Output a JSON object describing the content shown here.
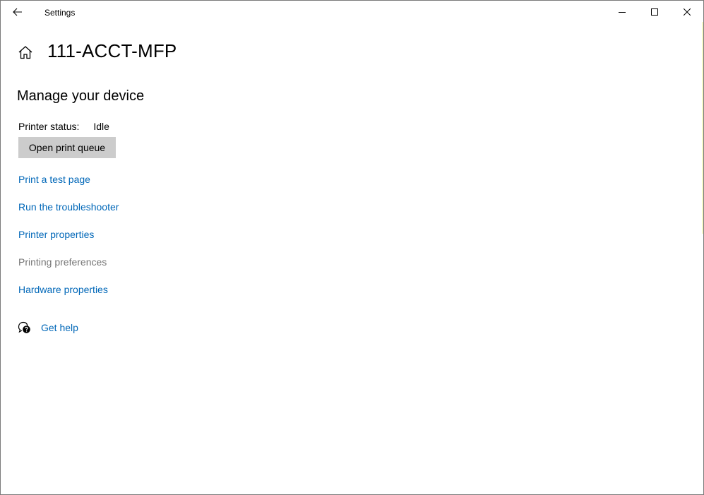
{
  "window": {
    "title": "Settings"
  },
  "icons": {
    "back": "back-arrow-icon",
    "home": "home-icon",
    "help": "help-chat-icon",
    "minimize": "minimize-icon",
    "maximize": "maximize-icon",
    "close": "close-icon"
  },
  "page": {
    "title": "111-ACCT-MFP",
    "section_heading": "Manage your device"
  },
  "status": {
    "label": "Printer status:",
    "value": "Idle"
  },
  "actions": {
    "open_queue_label": "Open print queue"
  },
  "links": [
    {
      "label": "Print a test page",
      "enabled": true
    },
    {
      "label": "Run the troubleshooter",
      "enabled": true
    },
    {
      "label": "Printer properties",
      "enabled": true
    },
    {
      "label": "Printing preferences",
      "enabled": false
    },
    {
      "label": "Hardware properties",
      "enabled": true
    }
  ],
  "help": {
    "label": "Get help"
  },
  "colors": {
    "link": "#0067b8",
    "disabled_link": "#767676",
    "button_bg": "#cccccc"
  }
}
